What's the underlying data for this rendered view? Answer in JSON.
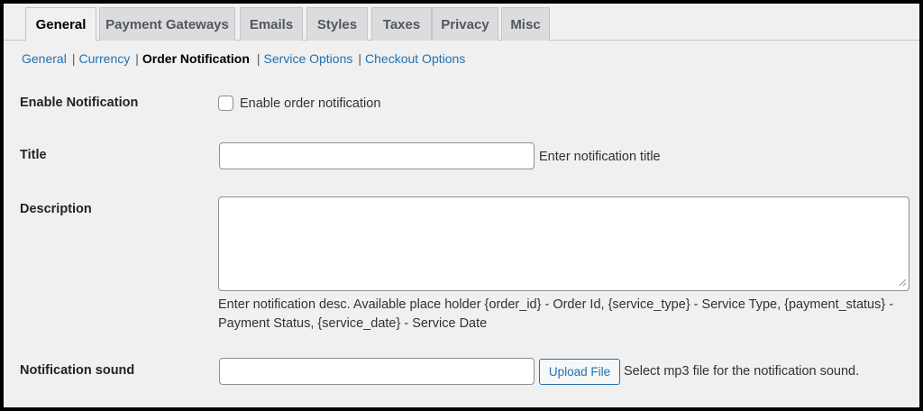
{
  "tabs": [
    {
      "label": "General",
      "active": true
    },
    {
      "label": "Payment Gateways",
      "active": false
    },
    {
      "label": "Emails",
      "active": false
    },
    {
      "label": "Styles",
      "active": false
    },
    {
      "label": "Taxes",
      "active": false
    },
    {
      "label": "Privacy",
      "active": false
    },
    {
      "label": "Misc",
      "active": false
    }
  ],
  "subnav": {
    "items": [
      "General",
      "Currency",
      "Order Notification",
      "Service Options",
      "Checkout Options"
    ],
    "separator": "|",
    "current": "Order Notification"
  },
  "form": {
    "enable": {
      "label": "Enable Notification",
      "checkbox_label": "Enable order notification",
      "checked": false
    },
    "title": {
      "label": "Title",
      "value": "",
      "help": "Enter notification title"
    },
    "description": {
      "label": "Description",
      "value": "",
      "help_line1": "Enter notification desc. Available place holder {order_id} - Order Id, {service_type} - Service Type, {payment_status} -",
      "help_line2": "Payment Status, {service_date} - Service Date"
    },
    "sound": {
      "label": "Notification sound",
      "value": "",
      "button": "Upload File",
      "help": "Select mp3 file for the notification sound."
    }
  },
  "colors": {
    "link": "#2271b1",
    "background": "#f0f0f1",
    "tab_inactive": "#dcdcde",
    "border": "#8c8f94"
  }
}
